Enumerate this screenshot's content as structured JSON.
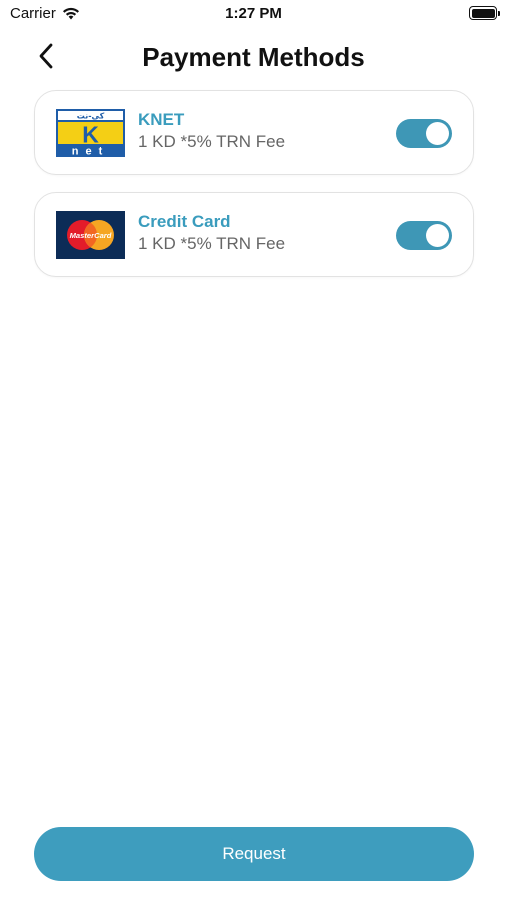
{
  "status_bar": {
    "carrier": "Carrier",
    "time": "1:27 PM",
    "wifi_icon": "wifi-icon",
    "battery_icon": "battery-icon"
  },
  "header": {
    "back_icon": "chevron-left-icon",
    "title": "Payment Methods"
  },
  "payment_methods": [
    {
      "name": "KNET",
      "fee": "1 KD *5% TRN Fee",
      "logo": "knet-logo",
      "logo_text_top": "كي-نت",
      "logo_letter": "K",
      "logo_text_bottom": "net",
      "enabled": true
    },
    {
      "name": "Credit Card",
      "fee": "1 KD *5% TRN Fee",
      "logo": "mastercard-logo",
      "logo_text": "MasterCard",
      "enabled": true
    }
  ],
  "request_button": {
    "label": "Request"
  },
  "colors": {
    "accent": "#3e9dbe",
    "method_name": "#3a9cbd",
    "toggle_on": "#3e97b6",
    "card_border": "#e2e2e2",
    "fee_text": "#666666"
  }
}
